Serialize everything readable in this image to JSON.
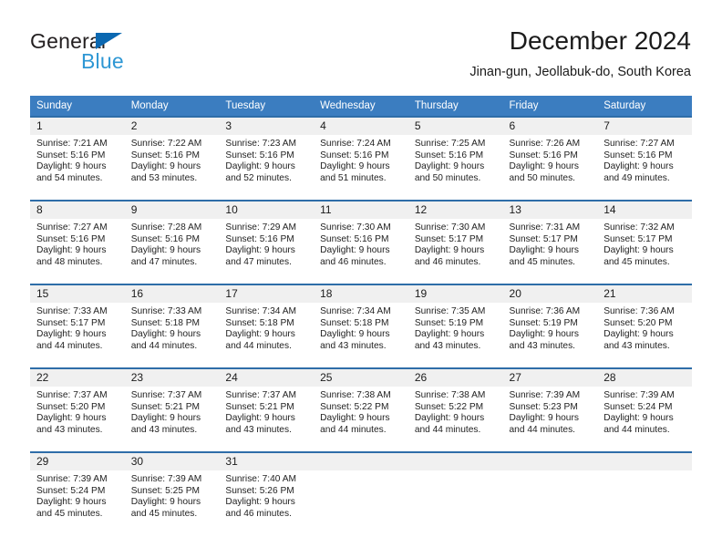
{
  "brand": {
    "name_part1": "General",
    "name_part2": "Blue",
    "triangle_color": "#0b68b1",
    "blue_text_color": "#2e97d4"
  },
  "header": {
    "title": "December 2024",
    "subtitle": "Jinan-gun, Jeollabuk-do, South Korea"
  },
  "theme": {
    "header_bg": "#3b7dc0",
    "row_border": "#2e6da8",
    "daynum_bg": "#f0f0f0"
  },
  "weekdays": [
    "Sunday",
    "Monday",
    "Tuesday",
    "Wednesday",
    "Thursday",
    "Friday",
    "Saturday"
  ],
  "weeks": [
    [
      {
        "day": "1",
        "sunrise": "Sunrise: 7:21 AM",
        "sunset": "Sunset: 5:16 PM",
        "daylight1": "Daylight: 9 hours",
        "daylight2": "and 54 minutes."
      },
      {
        "day": "2",
        "sunrise": "Sunrise: 7:22 AM",
        "sunset": "Sunset: 5:16 PM",
        "daylight1": "Daylight: 9 hours",
        "daylight2": "and 53 minutes."
      },
      {
        "day": "3",
        "sunrise": "Sunrise: 7:23 AM",
        "sunset": "Sunset: 5:16 PM",
        "daylight1": "Daylight: 9 hours",
        "daylight2": "and 52 minutes."
      },
      {
        "day": "4",
        "sunrise": "Sunrise: 7:24 AM",
        "sunset": "Sunset: 5:16 PM",
        "daylight1": "Daylight: 9 hours",
        "daylight2": "and 51 minutes."
      },
      {
        "day": "5",
        "sunrise": "Sunrise: 7:25 AM",
        "sunset": "Sunset: 5:16 PM",
        "daylight1": "Daylight: 9 hours",
        "daylight2": "and 50 minutes."
      },
      {
        "day": "6",
        "sunrise": "Sunrise: 7:26 AM",
        "sunset": "Sunset: 5:16 PM",
        "daylight1": "Daylight: 9 hours",
        "daylight2": "and 50 minutes."
      },
      {
        "day": "7",
        "sunrise": "Sunrise: 7:27 AM",
        "sunset": "Sunset: 5:16 PM",
        "daylight1": "Daylight: 9 hours",
        "daylight2": "and 49 minutes."
      }
    ],
    [
      {
        "day": "8",
        "sunrise": "Sunrise: 7:27 AM",
        "sunset": "Sunset: 5:16 PM",
        "daylight1": "Daylight: 9 hours",
        "daylight2": "and 48 minutes."
      },
      {
        "day": "9",
        "sunrise": "Sunrise: 7:28 AM",
        "sunset": "Sunset: 5:16 PM",
        "daylight1": "Daylight: 9 hours",
        "daylight2": "and 47 minutes."
      },
      {
        "day": "10",
        "sunrise": "Sunrise: 7:29 AM",
        "sunset": "Sunset: 5:16 PM",
        "daylight1": "Daylight: 9 hours",
        "daylight2": "and 47 minutes."
      },
      {
        "day": "11",
        "sunrise": "Sunrise: 7:30 AM",
        "sunset": "Sunset: 5:16 PM",
        "daylight1": "Daylight: 9 hours",
        "daylight2": "and 46 minutes."
      },
      {
        "day": "12",
        "sunrise": "Sunrise: 7:30 AM",
        "sunset": "Sunset: 5:17 PM",
        "daylight1": "Daylight: 9 hours",
        "daylight2": "and 46 minutes."
      },
      {
        "day": "13",
        "sunrise": "Sunrise: 7:31 AM",
        "sunset": "Sunset: 5:17 PM",
        "daylight1": "Daylight: 9 hours",
        "daylight2": "and 45 minutes."
      },
      {
        "day": "14",
        "sunrise": "Sunrise: 7:32 AM",
        "sunset": "Sunset: 5:17 PM",
        "daylight1": "Daylight: 9 hours",
        "daylight2": "and 45 minutes."
      }
    ],
    [
      {
        "day": "15",
        "sunrise": "Sunrise: 7:33 AM",
        "sunset": "Sunset: 5:17 PM",
        "daylight1": "Daylight: 9 hours",
        "daylight2": "and 44 minutes."
      },
      {
        "day": "16",
        "sunrise": "Sunrise: 7:33 AM",
        "sunset": "Sunset: 5:18 PM",
        "daylight1": "Daylight: 9 hours",
        "daylight2": "and 44 minutes."
      },
      {
        "day": "17",
        "sunrise": "Sunrise: 7:34 AM",
        "sunset": "Sunset: 5:18 PM",
        "daylight1": "Daylight: 9 hours",
        "daylight2": "and 44 minutes."
      },
      {
        "day": "18",
        "sunrise": "Sunrise: 7:34 AM",
        "sunset": "Sunset: 5:18 PM",
        "daylight1": "Daylight: 9 hours",
        "daylight2": "and 43 minutes."
      },
      {
        "day": "19",
        "sunrise": "Sunrise: 7:35 AM",
        "sunset": "Sunset: 5:19 PM",
        "daylight1": "Daylight: 9 hours",
        "daylight2": "and 43 minutes."
      },
      {
        "day": "20",
        "sunrise": "Sunrise: 7:36 AM",
        "sunset": "Sunset: 5:19 PM",
        "daylight1": "Daylight: 9 hours",
        "daylight2": "and 43 minutes."
      },
      {
        "day": "21",
        "sunrise": "Sunrise: 7:36 AM",
        "sunset": "Sunset: 5:20 PM",
        "daylight1": "Daylight: 9 hours",
        "daylight2": "and 43 minutes."
      }
    ],
    [
      {
        "day": "22",
        "sunrise": "Sunrise: 7:37 AM",
        "sunset": "Sunset: 5:20 PM",
        "daylight1": "Daylight: 9 hours",
        "daylight2": "and 43 minutes."
      },
      {
        "day": "23",
        "sunrise": "Sunrise: 7:37 AM",
        "sunset": "Sunset: 5:21 PM",
        "daylight1": "Daylight: 9 hours",
        "daylight2": "and 43 minutes."
      },
      {
        "day": "24",
        "sunrise": "Sunrise: 7:37 AM",
        "sunset": "Sunset: 5:21 PM",
        "daylight1": "Daylight: 9 hours",
        "daylight2": "and 43 minutes."
      },
      {
        "day": "25",
        "sunrise": "Sunrise: 7:38 AM",
        "sunset": "Sunset: 5:22 PM",
        "daylight1": "Daylight: 9 hours",
        "daylight2": "and 44 minutes."
      },
      {
        "day": "26",
        "sunrise": "Sunrise: 7:38 AM",
        "sunset": "Sunset: 5:22 PM",
        "daylight1": "Daylight: 9 hours",
        "daylight2": "and 44 minutes."
      },
      {
        "day": "27",
        "sunrise": "Sunrise: 7:39 AM",
        "sunset": "Sunset: 5:23 PM",
        "daylight1": "Daylight: 9 hours",
        "daylight2": "and 44 minutes."
      },
      {
        "day": "28",
        "sunrise": "Sunrise: 7:39 AM",
        "sunset": "Sunset: 5:24 PM",
        "daylight1": "Daylight: 9 hours",
        "daylight2": "and 44 minutes."
      }
    ],
    [
      {
        "day": "29",
        "sunrise": "Sunrise: 7:39 AM",
        "sunset": "Sunset: 5:24 PM",
        "daylight1": "Daylight: 9 hours",
        "daylight2": "and 45 minutes."
      },
      {
        "day": "30",
        "sunrise": "Sunrise: 7:39 AM",
        "sunset": "Sunset: 5:25 PM",
        "daylight1": "Daylight: 9 hours",
        "daylight2": "and 45 minutes."
      },
      {
        "day": "31",
        "sunrise": "Sunrise: 7:40 AM",
        "sunset": "Sunset: 5:26 PM",
        "daylight1": "Daylight: 9 hours",
        "daylight2": "and 46 minutes."
      },
      {
        "day": "",
        "sunrise": "",
        "sunset": "",
        "daylight1": "",
        "daylight2": ""
      },
      {
        "day": "",
        "sunrise": "",
        "sunset": "",
        "daylight1": "",
        "daylight2": ""
      },
      {
        "day": "",
        "sunrise": "",
        "sunset": "",
        "daylight1": "",
        "daylight2": ""
      },
      {
        "day": "",
        "sunrise": "",
        "sunset": "",
        "daylight1": "",
        "daylight2": ""
      }
    ]
  ]
}
